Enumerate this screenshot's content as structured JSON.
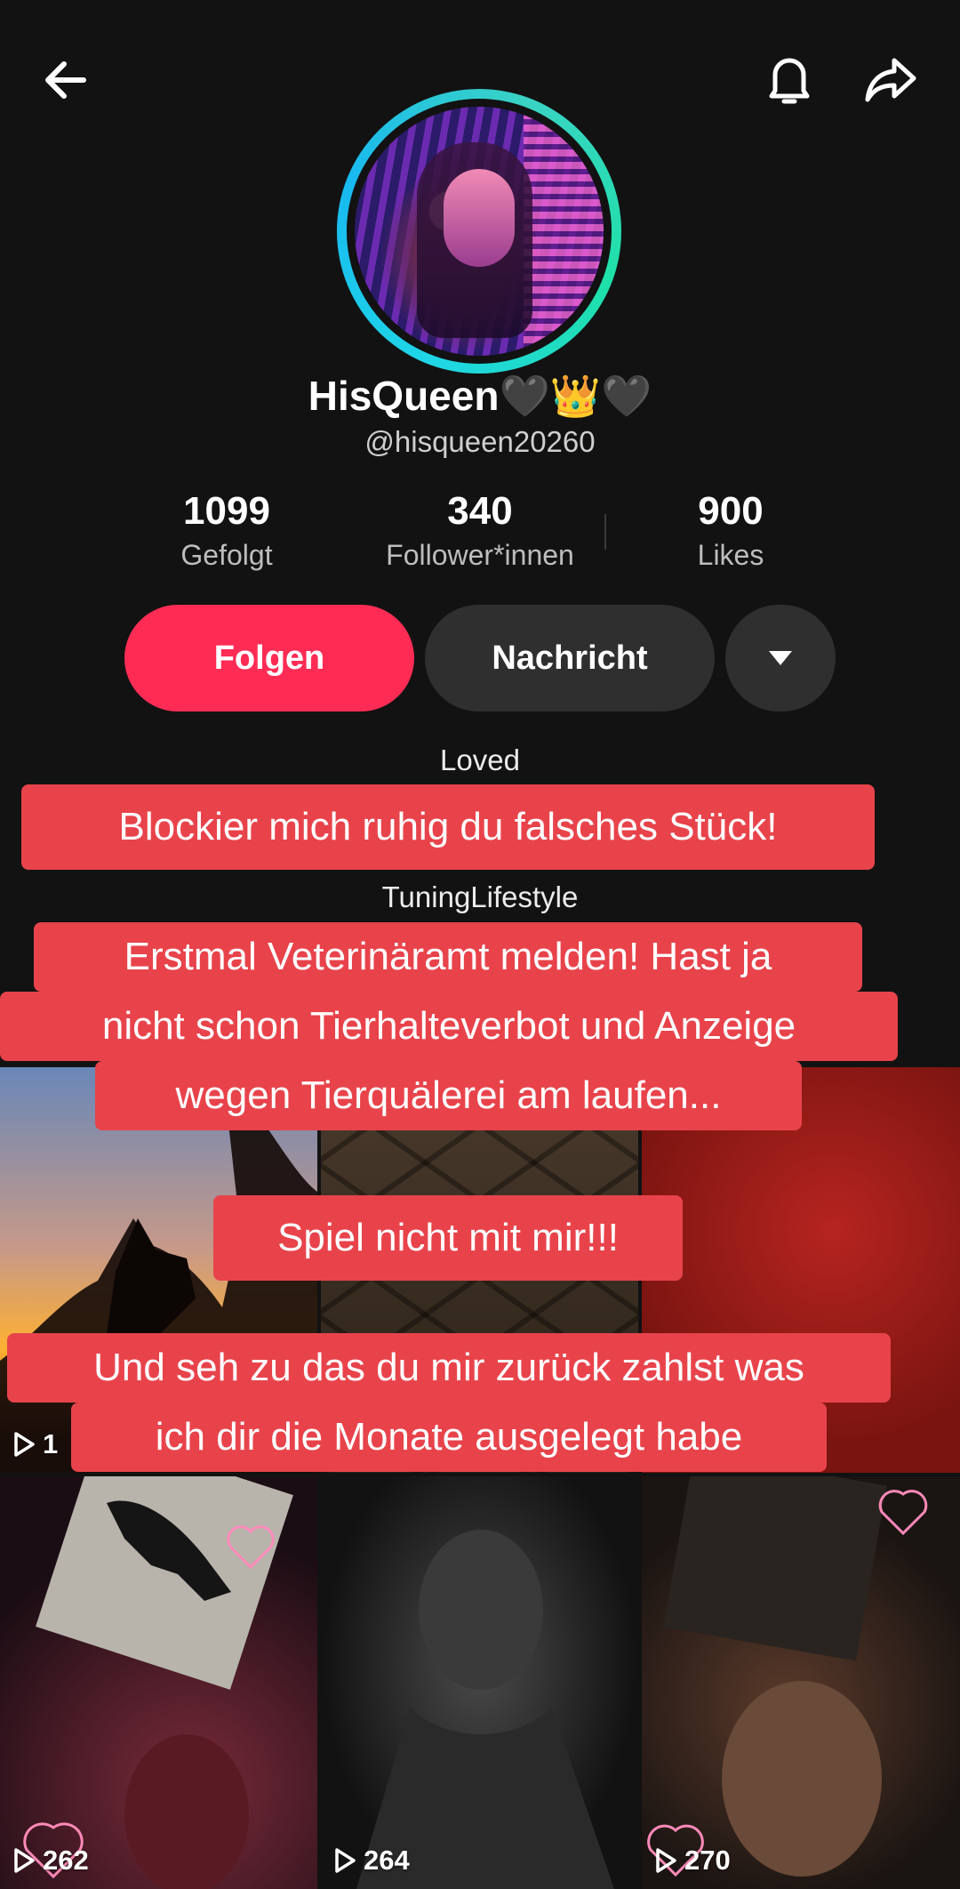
{
  "header": {
    "back_icon": "arrow-left-icon",
    "bell_icon": "bell-icon",
    "share_icon": "share-arrow-icon"
  },
  "profile": {
    "display_name": "HisQueen🖤👑🖤",
    "handle": "@hisqueen20260",
    "stats": [
      {
        "value": "1099",
        "label": "Gefolgt"
      },
      {
        "value": "340",
        "label": "Follower*innen"
      },
      {
        "value": "900",
        "label": "Likes"
      }
    ],
    "follow_label": "Folgen",
    "message_label": "Nachricht",
    "bio_line1": "Loved",
    "bio_line2": "TuningLifestyle"
  },
  "captions": {
    "c1": "Blockier mich ruhig du falsches Stück!",
    "c2_l1": "Erstmal Veterinäramt melden! Hast ja",
    "c2_l2": "nicht schon Tierhalteverbot und Anzeige",
    "c2_l3": "wegen Tierquälerei am laufen...",
    "c3": "Spiel nicht mit mir!!!",
    "c4_l1": "Und seh zu das du mir zurück zahlst was",
    "c4_l2": "ich dir die Monate ausgelegt habe"
  },
  "grid": {
    "tile1_count": "1",
    "tile4_count": "262",
    "tile5_count": "264",
    "tile6_count": "270"
  },
  "colors": {
    "background": "#121212",
    "follow": "#fe2c55",
    "caption_bg": "#e8434b",
    "avatar_ring": "#1fd6e6"
  }
}
